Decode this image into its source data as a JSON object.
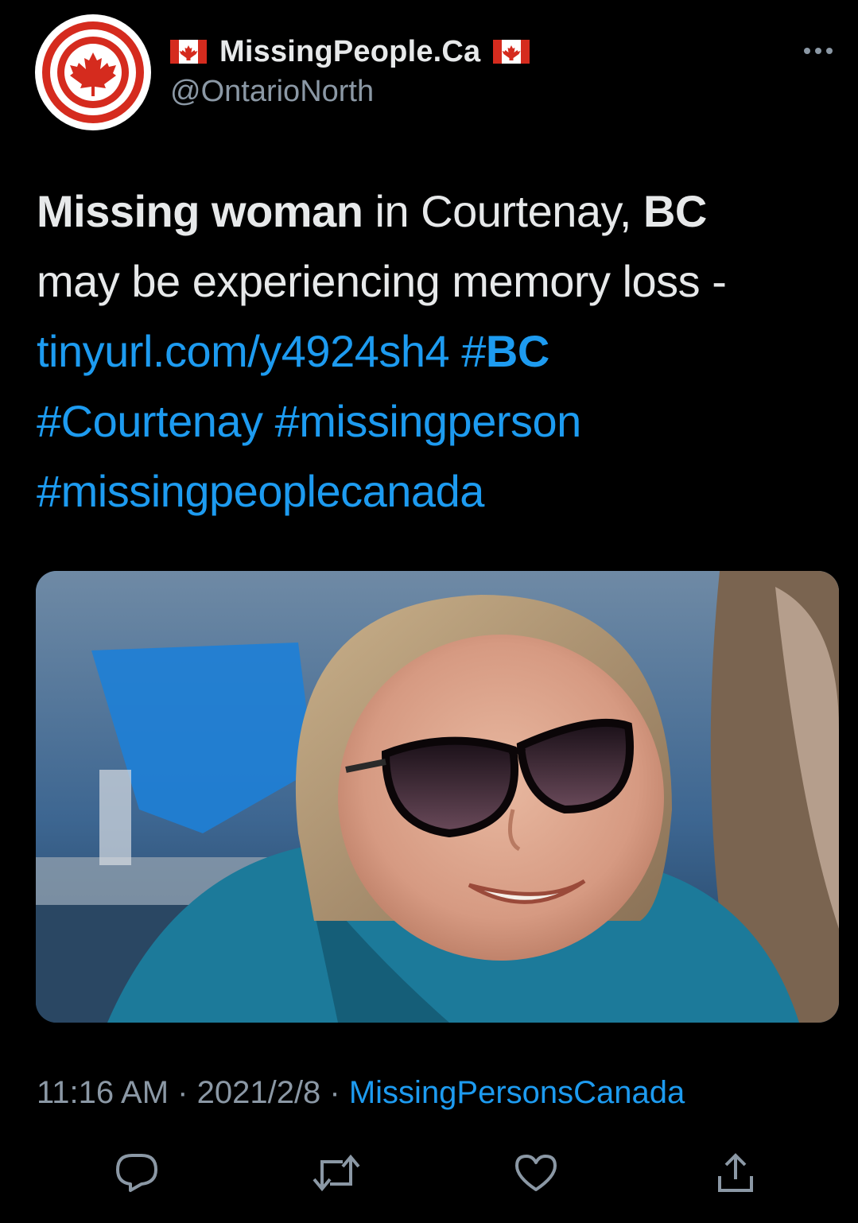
{
  "account": {
    "display_name": "MissingPeople.Ca",
    "handle": "@OntarioNorth"
  },
  "tweet": {
    "line1_bold1": "Missing woman",
    "line1_plain": " in Courtenay, ",
    "line1_bold2": "BC",
    "line2": "may be experiencing memory loss -",
    "link": "tinyurl.com/y4924sh4",
    "hashtag_bc_prefix": "#",
    "hashtag_bc_text": "BC",
    "hashtag2": "#Courtenay",
    "hashtag3": "#missingperson",
    "hashtag4": "#missingpeoplecanada"
  },
  "meta": {
    "time": "11:16 AM",
    "sep1": " · ",
    "date": "2021/2/8",
    "sep2": " · ",
    "source": "MissingPersonsCanada"
  },
  "icons": {
    "avatar": "canada-maple-leaf-logo",
    "flag": "canada-flag-icon",
    "more": "more-options-icon",
    "reply": "reply-icon",
    "retweet": "retweet-icon",
    "like": "heart-icon",
    "share": "share-icon"
  },
  "colors": {
    "background": "#000000",
    "link": "#1d9bf0",
    "muted": "#8b98a5",
    "brand_red": "#d52b1e"
  }
}
